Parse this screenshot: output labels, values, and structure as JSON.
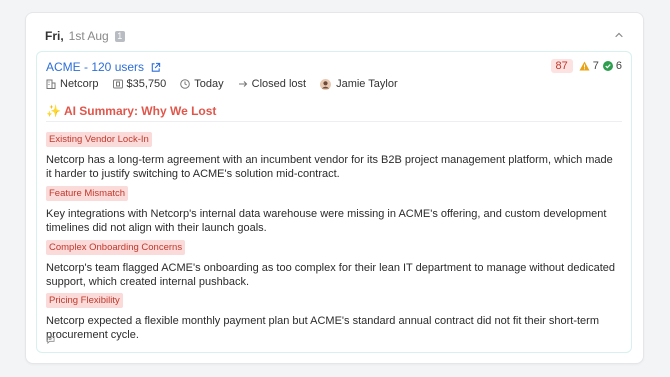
{
  "day": {
    "name": "Fri,",
    "date": "1st Aug",
    "count": "1"
  },
  "card": {
    "title": "ACME - 120 users",
    "score": "87",
    "warnings": "7",
    "checks": "6",
    "meta": {
      "company": "Netcorp",
      "amount": "$35,750",
      "date": "Today",
      "stage": "Closed lost",
      "owner": "Jamie Taylor"
    },
    "ai_summary_title": "AI Summary: Why We Lost",
    "reasons": [
      {
        "tag": "Existing Vendor Lock-In",
        "text": "Netcorp has a long-term agreement with an incumbent vendor for its B2B project management platform, which made it harder to justify switching to ACME's solution mid-contract."
      },
      {
        "tag": "Feature Mismatch",
        "text": "Key integrations with Netcorp's internal data warehouse were missing in ACME's offering, and custom development timelines did not align with their launch goals."
      },
      {
        "tag": "Complex Onboarding Concerns",
        "text": "Netcorp's team flagged ACME's onboarding as too complex for their lean IT department to manage without dedicated support, which created internal pushback."
      },
      {
        "tag": "Pricing Flexibility",
        "text": "Netcorp expected a flexible monthly payment plan but ACME's standard annual contract did not fit their short-term procurement cycle."
      }
    ]
  },
  "icons": {
    "collapse": "chevron-up-icon",
    "external": "external-link-icon",
    "company": "building-icon",
    "amount": "money-icon",
    "date": "clock-icon",
    "stage": "arrow-right-icon",
    "owner": "avatar",
    "comment": "comment-icon"
  },
  "colors": {
    "link": "#2d6fd8",
    "accent_red": "#e0564b",
    "tag_bg": "#fbdada",
    "warning": "#e8a317",
    "success": "#2e9e4f"
  }
}
